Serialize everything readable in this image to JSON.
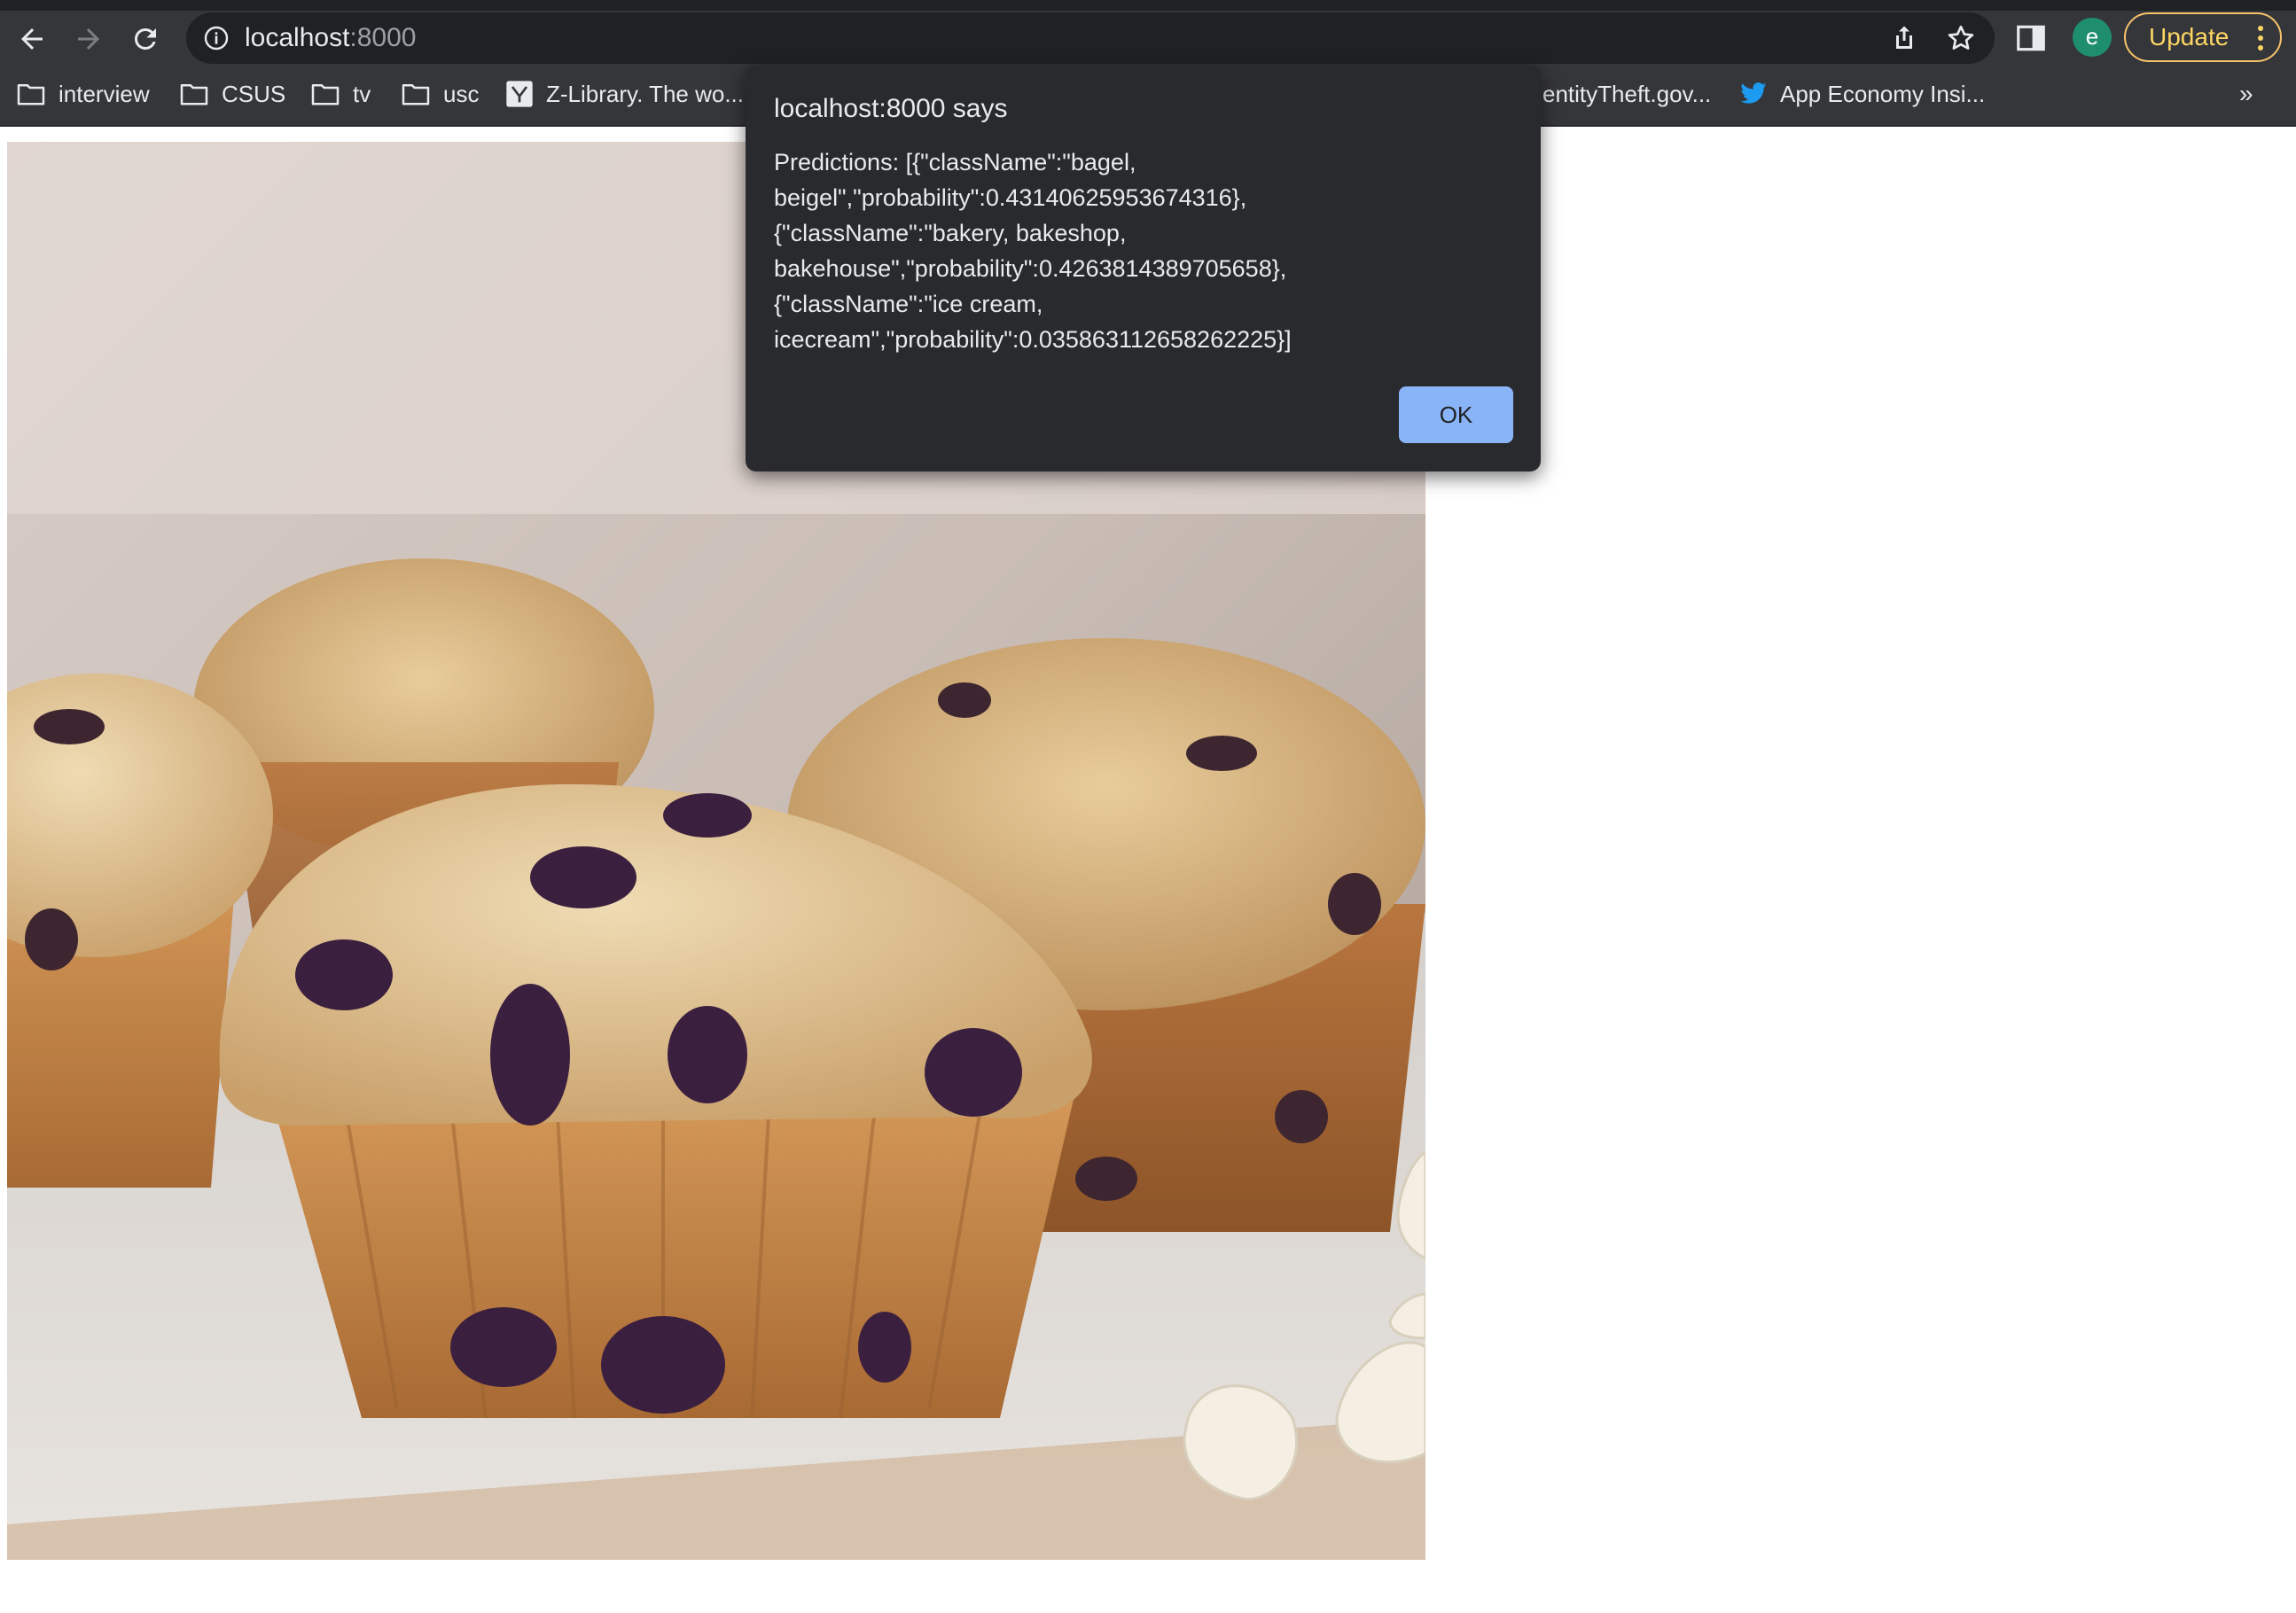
{
  "browser": {
    "url_host": "localhost",
    "url_port": ":8000",
    "avatar_letter": "e",
    "update_label": "Update",
    "bookmarks": [
      {
        "label": "interview",
        "icon": "folder-icon"
      },
      {
        "label": "CSUS",
        "icon": "folder-icon"
      },
      {
        "label": "tv",
        "icon": "folder-icon"
      },
      {
        "label": "usc",
        "icon": "folder-icon"
      },
      {
        "label": "Z-Library. The wo...",
        "icon": "zlibrary-icon"
      },
      {
        "label": "entityTheft.gov...",
        "icon": ""
      },
      {
        "label": "App Economy Insi...",
        "icon": "twitter-icon"
      }
    ],
    "bookmarks_more": "»"
  },
  "dialog": {
    "title": "localhost:8000 says",
    "message_lines": [
      "Predictions: [{\"className\":\"bagel,",
      "beigel\",\"probability\":0.43140625953674316},",
      "{\"className\":\"bakery, bakeshop,",
      "bakehouse\",\"probability\":0.4263814389705658},",
      "{\"className\":\"ice cream,",
      "icecream\",\"probability\":0.035863112658262225}]"
    ],
    "ok_label": "OK"
  },
  "colors": {
    "toolbar": "#35363a",
    "dialog_bg": "#292a2d",
    "ok_button": "#8ab4f8",
    "update_accent": "#f6c26b"
  }
}
